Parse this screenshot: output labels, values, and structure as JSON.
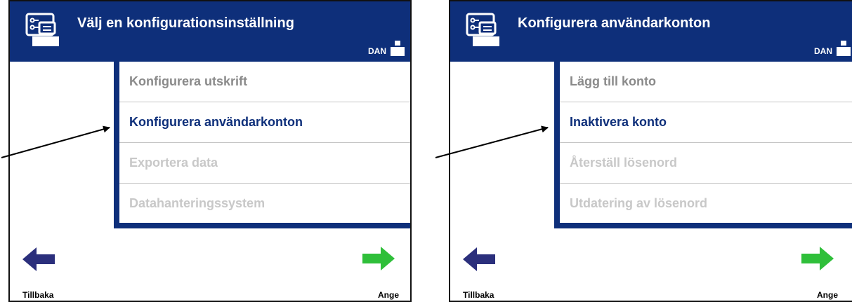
{
  "screens": [
    {
      "title": "Välj en konfigurationsinställning",
      "user": "DAN",
      "items": [
        {
          "label": "Konfigurera utskrift",
          "color": "#8a8a8a"
        },
        {
          "label": "Konfigurera användarkonton",
          "color": "#0e2f7a"
        },
        {
          "label": "Exportera data",
          "color": "#c8c8c8"
        },
        {
          "label": "Datahanteringssystem",
          "color": "#c8c8c8"
        }
      ],
      "back_label": "Tillbaka",
      "enter_label": "Ange"
    },
    {
      "title": "Konfigurera användarkonton",
      "user": "DAN",
      "items": [
        {
          "label": "Lägg till konto",
          "color": "#8a8a8a"
        },
        {
          "label": "Inaktivera konto",
          "color": "#0e2f7a"
        },
        {
          "label": "Återställ lösenord",
          "color": "#c8c8c8"
        },
        {
          "label": "Utdatering av lösenord",
          "color": "#c8c8c8"
        }
      ],
      "back_label": "Tillbaka",
      "enter_label": "Ange"
    }
  ],
  "colors": {
    "header": "#0e2f7a",
    "back_arrow": "#2b2f7c",
    "enter_arrow": "#2fbf3a"
  },
  "icons": [
    "settings-icon",
    "user-icon",
    "back-arrow-icon",
    "enter-arrow-icon"
  ]
}
